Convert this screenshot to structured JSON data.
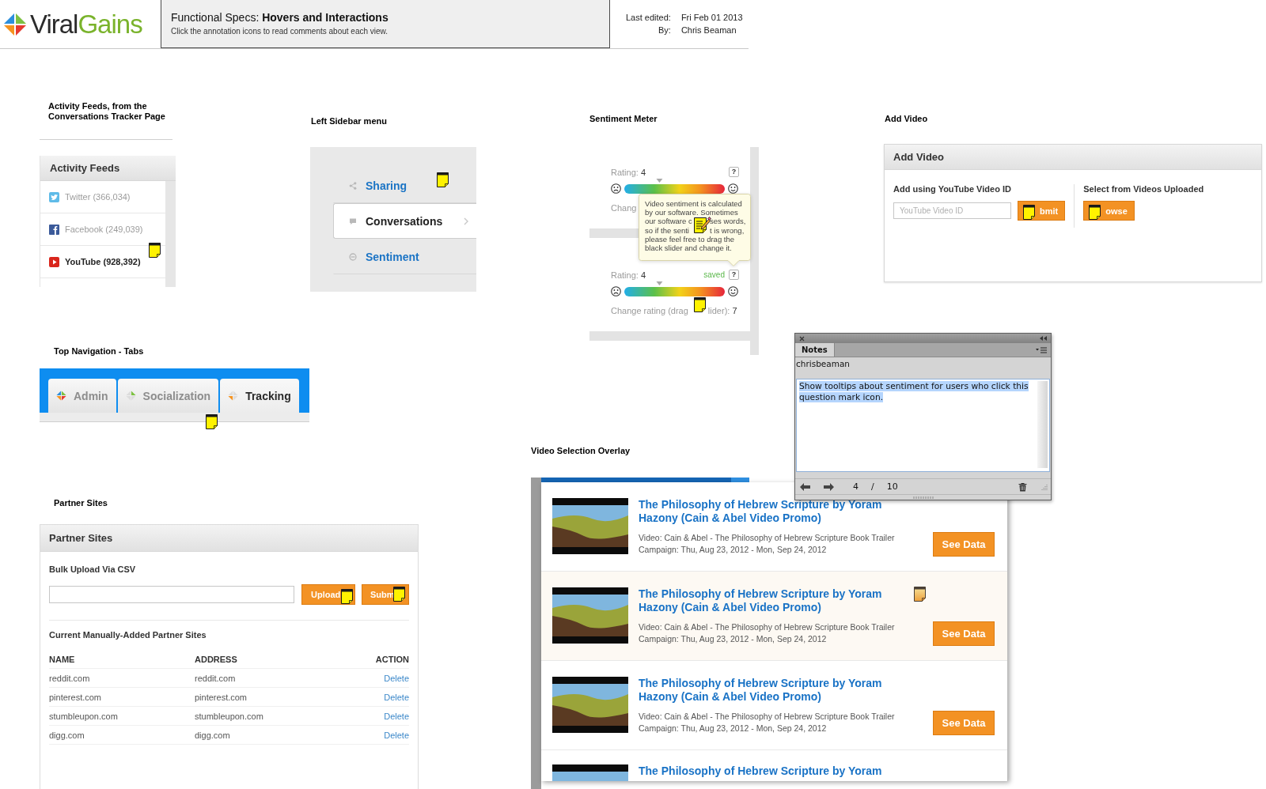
{
  "header": {
    "logo": {
      "start": "Viral",
      "end": "Gains"
    },
    "title": "Functional Specs: **Hovers and Interactions**",
    "subtitle": "Click the annotation icons to read comments about each view.",
    "meta": [
      {
        "label": "Last edited:",
        "value": "Fri Feb 01 2013"
      },
      {
        "label": "By:",
        "value": "Chris Beaman"
      }
    ]
  },
  "activity_feeds": {
    "caption": "Activity Feeds, from the Conversations Tracker Page",
    "title": "Activity Feeds",
    "items": [
      {
        "kind": "twitter",
        "label": "Twitter (366,034)",
        "selected": false
      },
      {
        "kind": "facebook",
        "label": "Facebook (249,039)",
        "selected": false
      },
      {
        "kind": "youtube",
        "label": "YouTube (928,392)",
        "selected": true
      }
    ]
  },
  "sidebar_menu": {
    "caption": "Left Sidebar menu",
    "items": [
      {
        "kind": "share",
        "label": "Sharing",
        "selected": false
      },
      {
        "kind": "comment",
        "label": "Conversations",
        "selected": true
      },
      {
        "kind": "sentiment",
        "label": "Sentiment",
        "selected": false
      }
    ]
  },
  "sentiment_meter": {
    "caption": "Sentiment Meter",
    "meters": [
      {
        "label": "Rating:",
        "value": "4",
        "help": "?",
        "level": 0.35,
        "hint": {
          "text": "Chang"
        }
      },
      {
        "label": "Rating:",
        "value": "4",
        "status": "saved",
        "help": "?",
        "level": 0.35,
        "hint": {
          "text": "Change rating (drag",
          "rest": "lider):",
          "value": "7"
        }
      }
    ],
    "tooltip": {
      "lines": [
        [
          "Video sentiment is calculated"
        ],
        [
          "by our software. Sometimes"
        ],
        [
          "our software c",
          "ses words,"
        ],
        [
          "so if the senti",
          "t is wrong,"
        ],
        [
          "please feel free to drag the"
        ],
        [
          "black slider and change it."
        ]
      ]
    }
  },
  "add_video": {
    "caption": "Add Video",
    "title": "Add Video",
    "columns": [
      {
        "label": "Add using YouTube Video ID",
        "placeholder": "YouTube Video ID",
        "button": "bmit"
      },
      {
        "label": "Select from Videos Uploaded",
        "button": "owse"
      }
    ]
  },
  "notes_panel": {
    "tab": "Notes",
    "author": "chrisbeaman",
    "text": "Show tooltips about sentiment for users who click this question mark icon.",
    "text_selected": true,
    "page": "4",
    "separator": "/",
    "total": "10"
  },
  "top_navigation": {
    "caption": "Top Navigation - Tabs",
    "tabs": [
      {
        "kind": "admin",
        "label": "Admin",
        "selected": false
      },
      {
        "kind": "socialization",
        "label": "Socialization",
        "selected": false
      },
      {
        "kind": "tracking",
        "label": "Tracking",
        "selected": true
      }
    ]
  },
  "partner_sites": {
    "caption": "Partner Sites",
    "title": "Partner Sites",
    "upload_label": "Bulk Upload Via CSV",
    "buttons": [
      "Upload",
      "Subm"
    ],
    "list_title": "Current Manually-Added Partner Sites",
    "columns": [
      "NAME",
      "ADDRESS",
      "ACTION"
    ],
    "rows": [
      [
        "reddit.com",
        "reddit.com",
        "Delete"
      ],
      [
        "pinterest.com",
        "pinterest.com",
        "Delete"
      ],
      [
        "stumbleupon.com",
        "stumbleupon.com",
        "Delete"
      ],
      [
        "digg.com",
        "digg.com",
        "Delete"
      ]
    ]
  },
  "video_overlay": {
    "caption": "Video Selection Overlay",
    "videos": [
      {
        "title": "The Philosophy of Hebrew Scripture by Yoram Hazony (Cain & Abel Video Promo)",
        "video": "Video: Cain & Abel - The Philosophy of Hebrew Scripture Book Trailer",
        "campaign": "Campaign: Thu, Aug 23, 2012 - Mon, Sep 24, 2012",
        "button": "See Data",
        "hovered": false
      },
      {
        "title": "The Philosophy of Hebrew Scripture by Yoram Hazony (Cain & Abel Video Promo)",
        "video": "Video: Cain & Abel - The Philosophy of Hebrew Scripture Book Trailer",
        "campaign": "Campaign: Thu, Aug 23, 2012 - Mon, Sep 24, 2012",
        "button": "See Data",
        "hovered": true
      },
      {
        "title": "The Philosophy of Hebrew Scripture by Yoram Hazony (Cain & Abel Video Promo)",
        "video": "Video: Cain & Abel - The Philosophy of Hebrew Scripture Book Trailer",
        "campaign": "Campaign: Thu, Aug 23, 2012 - Mon, Sep 24, 2012",
        "button": "See Data",
        "hovered": false
      },
      {
        "title": "The Philosophy of Hebrew Scripture by Yoram",
        "hovered": false
      }
    ]
  }
}
